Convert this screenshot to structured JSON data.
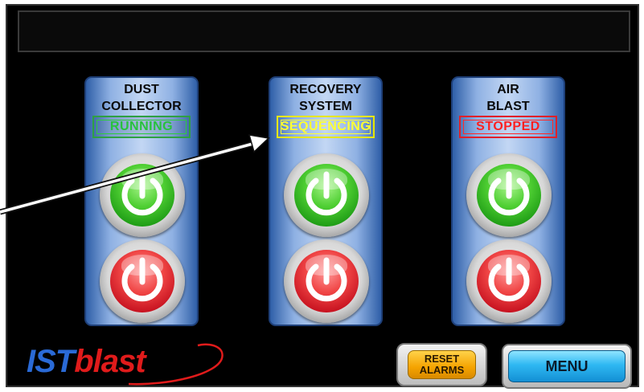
{
  "panels": [
    {
      "title_lines": [
        "DUST",
        "COLLECTOR"
      ],
      "status": "RUNNING",
      "status_color": "#2ecc40"
    },
    {
      "title_lines": [
        "RECOVERY",
        "SYSTEM"
      ],
      "status": "SEQUENCING",
      "status_color": "#ffff33"
    },
    {
      "title_lines": [
        "AIR",
        "BLAST"
      ],
      "status": "STOPPED",
      "status_color": "#ff2a2a"
    }
  ],
  "buttons": {
    "start_icon": "power-icon",
    "stop_icon": "power-icon",
    "start_color": "#3cc22a",
    "stop_color": "#e0202a"
  },
  "logo": {
    "part1": "IST",
    "part2": "blast",
    "color1": "#2a6ad6",
    "color2": "#e01b1b"
  },
  "footer": {
    "reset_line1": "RESET",
    "reset_line2": "ALARMS",
    "menu_label": "MENU"
  }
}
